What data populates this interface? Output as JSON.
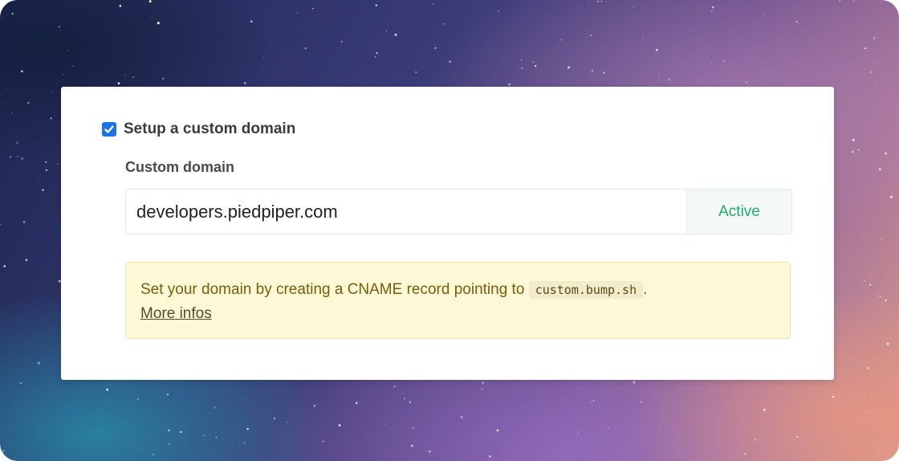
{
  "colors": {
    "checkbox": "#1a73e8",
    "status_active": "#1fae6b",
    "notice_background": "#fdf8d6",
    "notice_text": "#7a5d0c"
  },
  "custom_domain_toggle": {
    "label": "Setup a custom domain",
    "checked": true,
    "icon": "check-icon"
  },
  "custom_domain": {
    "label": "Custom domain",
    "value": "developers.piedpiper.com",
    "status": "Active"
  },
  "notice": {
    "text": "Set your domain by creating a CNAME record pointing to",
    "code": "custom.bump.sh",
    "suffix": ".",
    "link_label": "More infos"
  }
}
